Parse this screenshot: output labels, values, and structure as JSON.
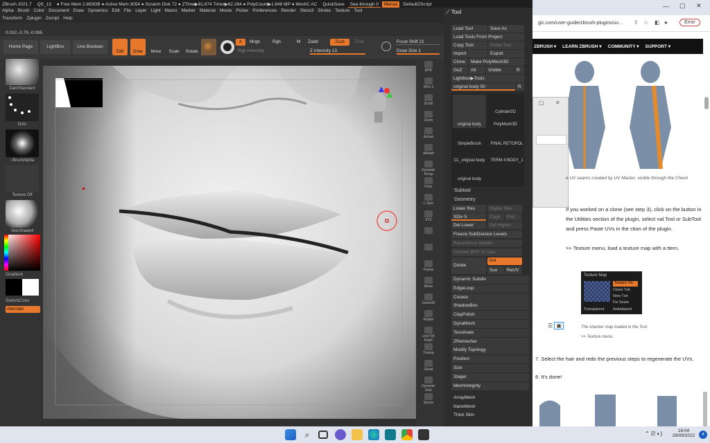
{
  "titlebar": {
    "app": "ZBrush 2021.7",
    "qs": "QS_13",
    "stats": "● Free Mem 2.893GB ● Active Mem 3054 ● Scratch Disk 72 ● ZTime▶91.674 Timer▶62.284 ● PolyCount▶1.648 MP ● MeshC AC",
    "quicksave": "QuickSave",
    "seethrough": "See-through 0",
    "menus": "Menus",
    "zscript": "DefaultZScript"
  },
  "menu_row1": [
    "Alpha",
    "Brush",
    "Color",
    "Document",
    "Draw",
    "Dynamics",
    "Edit",
    "File",
    "Layer",
    "Light",
    "Macro",
    "Marker",
    "Material",
    "Movie",
    "Picker",
    "Preferences",
    "Render",
    "Stencil",
    "Stroke",
    "Texture",
    "Tool"
  ],
  "menu_row2": [
    "Transform",
    "Zplugin",
    "Zscript",
    "Help"
  ],
  "coords": "0.032,-0.79,-0.095",
  "shelf": {
    "home": "Home Page",
    "lightbox": "LightBox",
    "livebool": "Live Boolean",
    "edit": "Edit",
    "draw": "Draw",
    "move": "Move",
    "scale": "Scale",
    "rotate": "Rotate",
    "a": "A",
    "mrgb": "Mrgb",
    "rgb": "Rgb",
    "m": "M",
    "zadd": "Zadd",
    "zsub": "Zsub",
    "zcut": "Zcut",
    "rgb_intensity": "Rgb Intensity",
    "z_intensity": "Z Intensity 13",
    "focal": "Focal Shift 21",
    "drawsize": "Draw Size 1"
  },
  "left": {
    "brush": "DamStandard",
    "stroke": "Dots",
    "alpha": "~BrushAlpha",
    "texture": "Texture Off",
    "material": "SkinShade4",
    "gradient": "Gradient",
    "switchcolor": "SwitchColor",
    "alternate": "Alternate"
  },
  "right_shelf": [
    "BPR",
    "SPix 3",
    "Scroll",
    "Zoom",
    "Actual",
    "AAHalf",
    "Dynamic Persp",
    "Floor",
    "L.Sym",
    "XYZ",
    "",
    "",
    "Frame",
    "Move",
    "Zoom3D",
    "Rotate",
    "Line Fill PolyF",
    "Transp",
    "Ghost",
    "Dynamic Solo",
    "Xpose"
  ],
  "tool": {
    "title": "Tool",
    "load": "Load Tool",
    "saveas": "Save As",
    "loadproj": "Load Tools From Project",
    "copy": "Copy Tool",
    "paste": "Paste Tool",
    "import": "Import",
    "export": "Export",
    "clone": "Clone",
    "makepoly": "Make PolyMesh3D",
    "goz": "GoZ",
    "all": "All",
    "visible": "Visible",
    "r": "R",
    "lightbox_tools": "Lightbox▶Tools",
    "orig_body": "original body  50",
    "thumbs": [
      "original body",
      "Cylinder3D",
      "SimpleBrush",
      "PolyMesh3D",
      "CL_original body",
      "FINAL RETOPOL",
      "original body",
      "TERM 4 BODY_1"
    ],
    "subtool": "Subtool",
    "geometry": "Geometry",
    "lowerres": "Lower Res",
    "higherres": "Higher Res",
    "sdiv": "SDiv 5",
    "cage": "Cage",
    "rstr": "Rstr",
    "dellower": "Del Lower",
    "delhigher": "Del Higher",
    "freeze": "Freeze SubDivision Levels",
    "reconstruct": "Reconstruct Subdiv",
    "convertbpr": "Convert BPR To Geo",
    "divide": "Divide",
    "smt": "Smt",
    "suv": "Suv",
    "reuv": "ReUV",
    "items": [
      "Dynamic Subdiv",
      "EdgeLoop",
      "Crease",
      "ShadowBox",
      "ClayPolish",
      "DynaMesh",
      "Tessimate",
      "ZRemesher",
      "Modify Topology",
      "Position",
      "Size",
      "Stager",
      "MeshIntegrity"
    ],
    "after": [
      "ArrayMesh",
      "NanoMesh",
      "Thick Skin"
    ]
  },
  "browser": {
    "url": "gic.com/user-guide/zbrush-plugins/uv...",
    "error": "Error",
    "nav": [
      "ZBRUSH ▾",
      "LEARN ZBRUSH ▾",
      "COMMUNITY ▾",
      "SUPPORT ▾"
    ],
    "caption1": "e UV seams created by UV Master, visible through the Check",
    "p1": "If you worked on a clone (see step 3), click on the button in the Utilities section of the plugin, select nal Tool or SubTool and press Paste UVs in the ction of the plugin.",
    "p2": ">> Texture menu, load a texture map with a ttern.",
    "texmap_title": "Texture Map",
    "texmap_btns": [
      "Texture On",
      "Clone Txtr",
      "New Txtr",
      "Fix Seam",
      "Antialiased"
    ],
    "texmap_transparent": "Transparent",
    "caption2": "The checker map loaded in the Tool",
    "caption3": ">> Texture menu.",
    "step7": "7. Select the hair and redo the previous steps to regenerate the UVs.",
    "step8": "8. It's done!"
  },
  "taskbar": {
    "time": "16:04",
    "date": "28/09/2022",
    "badge": "4"
  }
}
